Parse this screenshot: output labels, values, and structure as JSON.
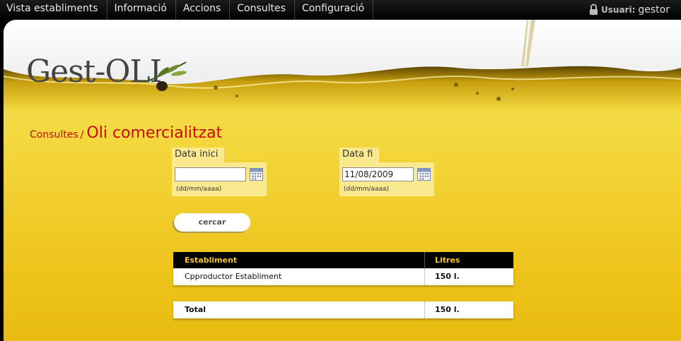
{
  "nav": {
    "items": [
      {
        "label": "Vista establiments"
      },
      {
        "label": "Informació"
      },
      {
        "label": "Accions"
      },
      {
        "label": "Consultes"
      },
      {
        "label": "Configuració"
      }
    ]
  },
  "user": {
    "label": "Usuari:",
    "name": "gestor"
  },
  "logo": {
    "text": "Gest-OLI"
  },
  "breadcrumb": {
    "parent": "Consultes",
    "separator": "/",
    "title": "Oli comercialitzat"
  },
  "filters": {
    "start": {
      "label": "Data inici",
      "value": "",
      "hint": "(dd/mm/aaaa)"
    },
    "end": {
      "label": "Data fi",
      "value": "11/08/2009",
      "hint": "(dd/mm/aaaa)"
    }
  },
  "search_button": "cercar",
  "table": {
    "headers": [
      "Establiment",
      "Litres"
    ],
    "rows": [
      {
        "establiment": "Cpproductor Establiment",
        "litres": "150 l."
      }
    ],
    "total": {
      "label": "Total",
      "value": "150 l."
    }
  },
  "colors": {
    "accent": "#c60d0d",
    "header_text": "#f5c72a",
    "panel_yellow": "#f4d940"
  }
}
